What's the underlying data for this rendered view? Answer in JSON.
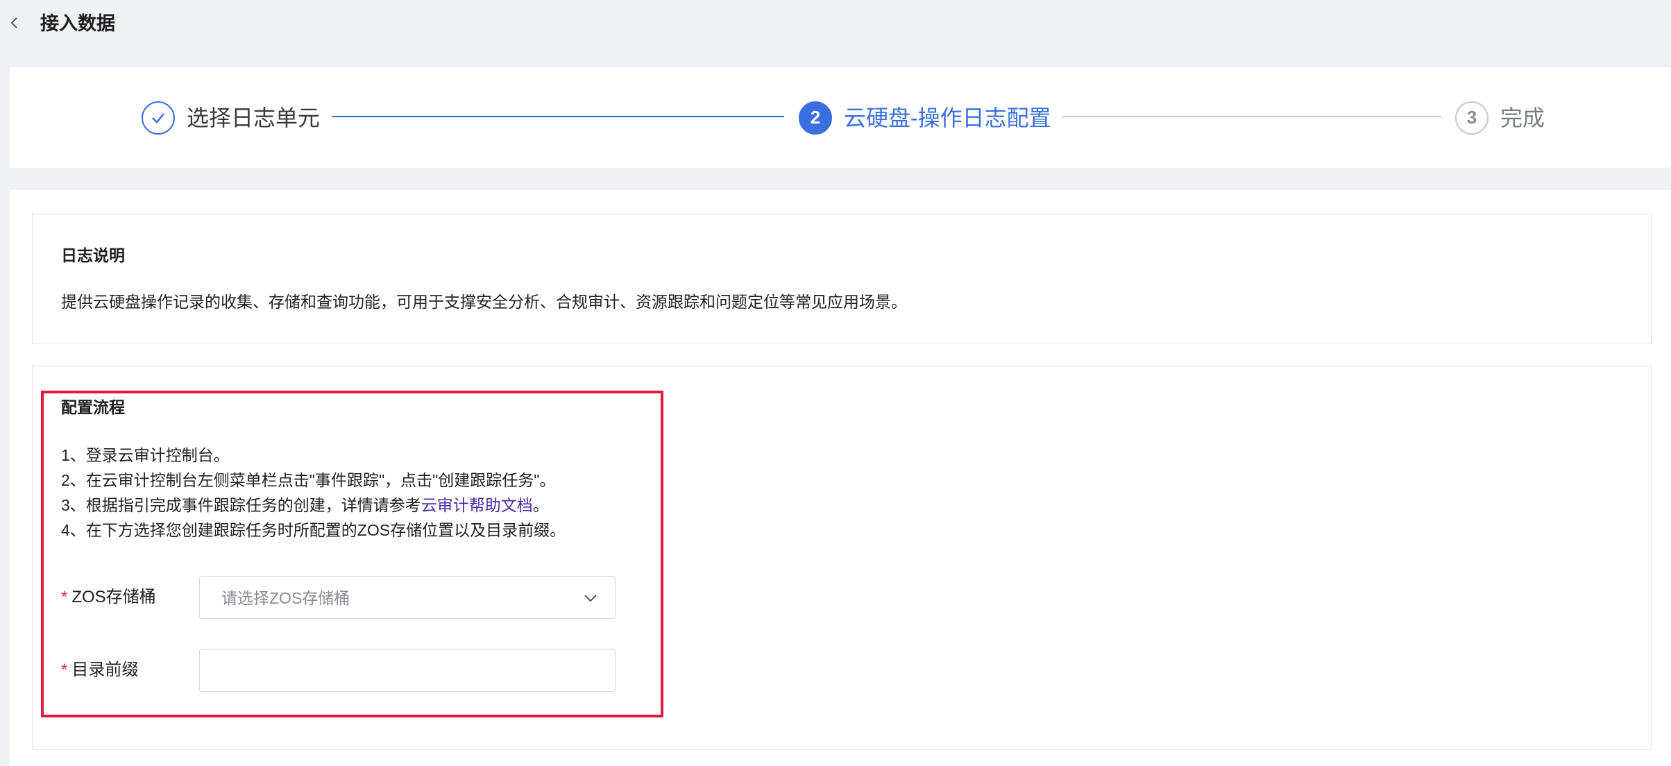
{
  "header": {
    "title": "接入数据",
    "back_icon": "chevron-left-icon"
  },
  "steps": [
    {
      "number": "✓",
      "label": "选择日志单元",
      "status": "done"
    },
    {
      "number": "2",
      "label": "云硬盘-操作日志配置",
      "status": "active"
    },
    {
      "number": "3",
      "label": "完成",
      "status": "todo"
    }
  ],
  "description": {
    "title": "日志说明",
    "text": "提供云硬盘操作记录的收集、存储和查询功能，可用于支撑安全分析、合规审计、资源跟踪和问题定位等常见应用场景。"
  },
  "flow": {
    "title": "配置流程",
    "step1": "1、登录云审计控制台。",
    "step2": "2、在云审计控制台左侧菜单栏点击\"事件跟踪\"，点击\"创建跟踪任务\"。",
    "step3_prefix": "3、根据指引完成事件跟踪任务的创建，详情请参考",
    "step3_link": "云审计帮助文档",
    "step3_suffix": "。",
    "step4": "4、在下方选择您创建跟踪任务时所配置的ZOS存储位置以及目录前缀。"
  },
  "form": {
    "bucket_label": "ZOS存储桶",
    "bucket_placeholder": "请选择ZOS存储桶",
    "prefix_label": "目录前缀",
    "prefix_value": "",
    "required_mark": "*"
  },
  "colors": {
    "accent": "#3b6fe0",
    "required": "#e0342c",
    "highlight": "#e01a3a",
    "link": "#4a2aa8"
  }
}
